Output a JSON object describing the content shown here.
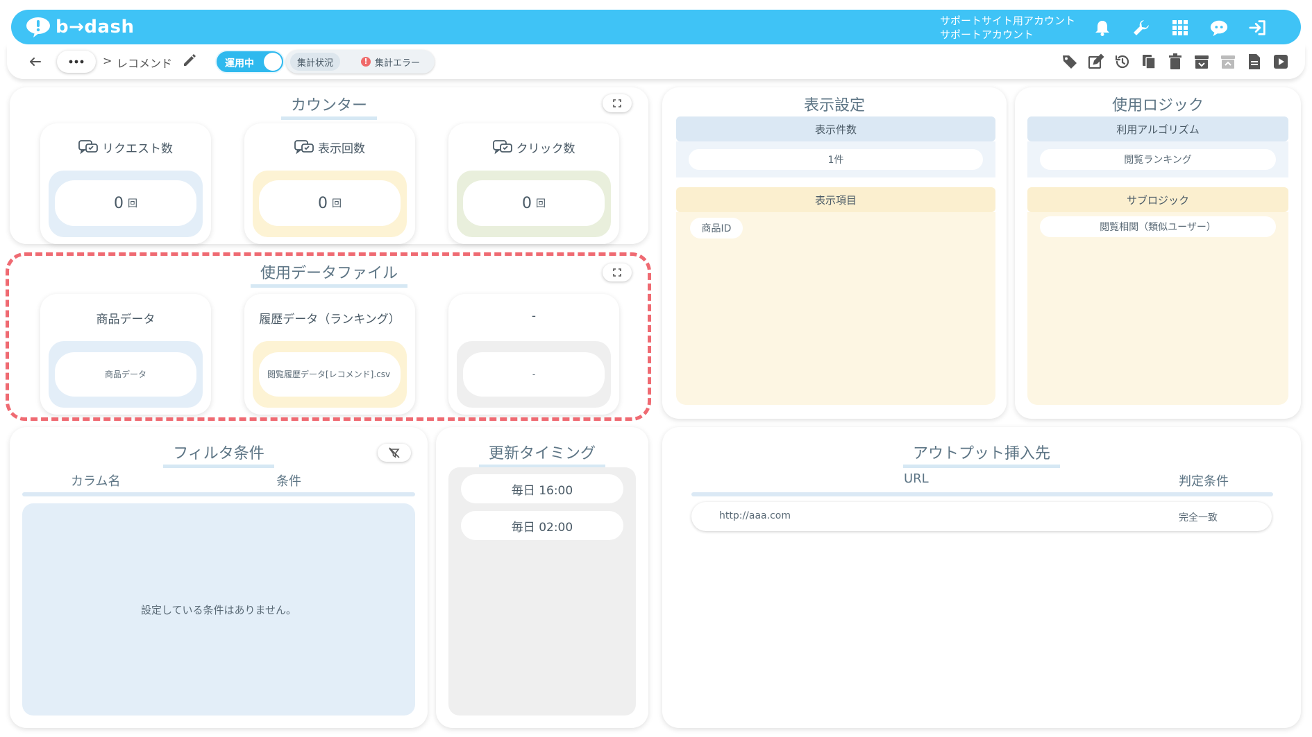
{
  "app": {
    "logo_text": "b→dash"
  },
  "header": {
    "account_line1": "サポートサイト用アカウント",
    "account_line2": "サポートアカウント",
    "icons": [
      "bell-icon",
      "wrench-icon",
      "apps-grid-icon",
      "support-chat-icon",
      "logout-icon"
    ]
  },
  "subbar": {
    "breadcrumb_sep": ">",
    "page_name": "レコメンド",
    "run_status": "運用中",
    "agg_status": "集計状況",
    "agg_error": "集計エラー",
    "tools": [
      "tag-icon",
      "edit-icon",
      "history-icon",
      "copy-icon",
      "trash-icon",
      "archive-icon",
      "unarchive-icon",
      "document-icon",
      "play-icon"
    ]
  },
  "counter": {
    "title": "カウンター",
    "items": [
      {
        "label": "リクエスト数",
        "value": "0",
        "unit": "回",
        "bg": "#e3eef8"
      },
      {
        "label": "表示回数",
        "value": "0",
        "unit": "回",
        "bg": "#fdf3d4"
      },
      {
        "label": "クリック数",
        "value": "0",
        "unit": "回",
        "bg": "#e9efdc"
      }
    ]
  },
  "data_files": {
    "title": "使用データファイル",
    "items": [
      {
        "label": "商品データ",
        "file": "商品データ",
        "bg": "#e3eef8"
      },
      {
        "label": "履歴データ（ランキング）",
        "file": "閲覧履歴データ[レコメンド].csv",
        "bg": "#fdf3d4"
      },
      {
        "label": "-",
        "file": "-",
        "bg": "#efefef"
      }
    ]
  },
  "display_settings": {
    "title": "表示設定",
    "count_header": "表示件数",
    "count_value": "1件",
    "items_header": "表示項目",
    "items": [
      "商品ID"
    ]
  },
  "logic": {
    "title": "使用ロジック",
    "algo_header": "利用アルゴリズム",
    "algo_value": "閲覧ランキング",
    "sub_header": "サブロジック",
    "sub_value": "閲覧相関（類似ユーザー）"
  },
  "filter": {
    "title": "フィルタ条件",
    "col_name": "カラム名",
    "col_cond": "条件",
    "empty": "設定している条件はありません。"
  },
  "timing": {
    "title": "更新タイミング",
    "times": [
      "毎日 16:00",
      "毎日 02:00"
    ]
  },
  "output": {
    "title": "アウトプット挿入先",
    "col_url": "URL",
    "col_cond": "判定条件",
    "rows": [
      {
        "url": "http://aaa.com",
        "cond": "完全一致"
      }
    ]
  },
  "colors": {
    "brand": "#3fc3f6",
    "highlight": "#ef6a72",
    "blue_panel": "#e3eef8",
    "yellow_panel": "#fdf3d4"
  }
}
